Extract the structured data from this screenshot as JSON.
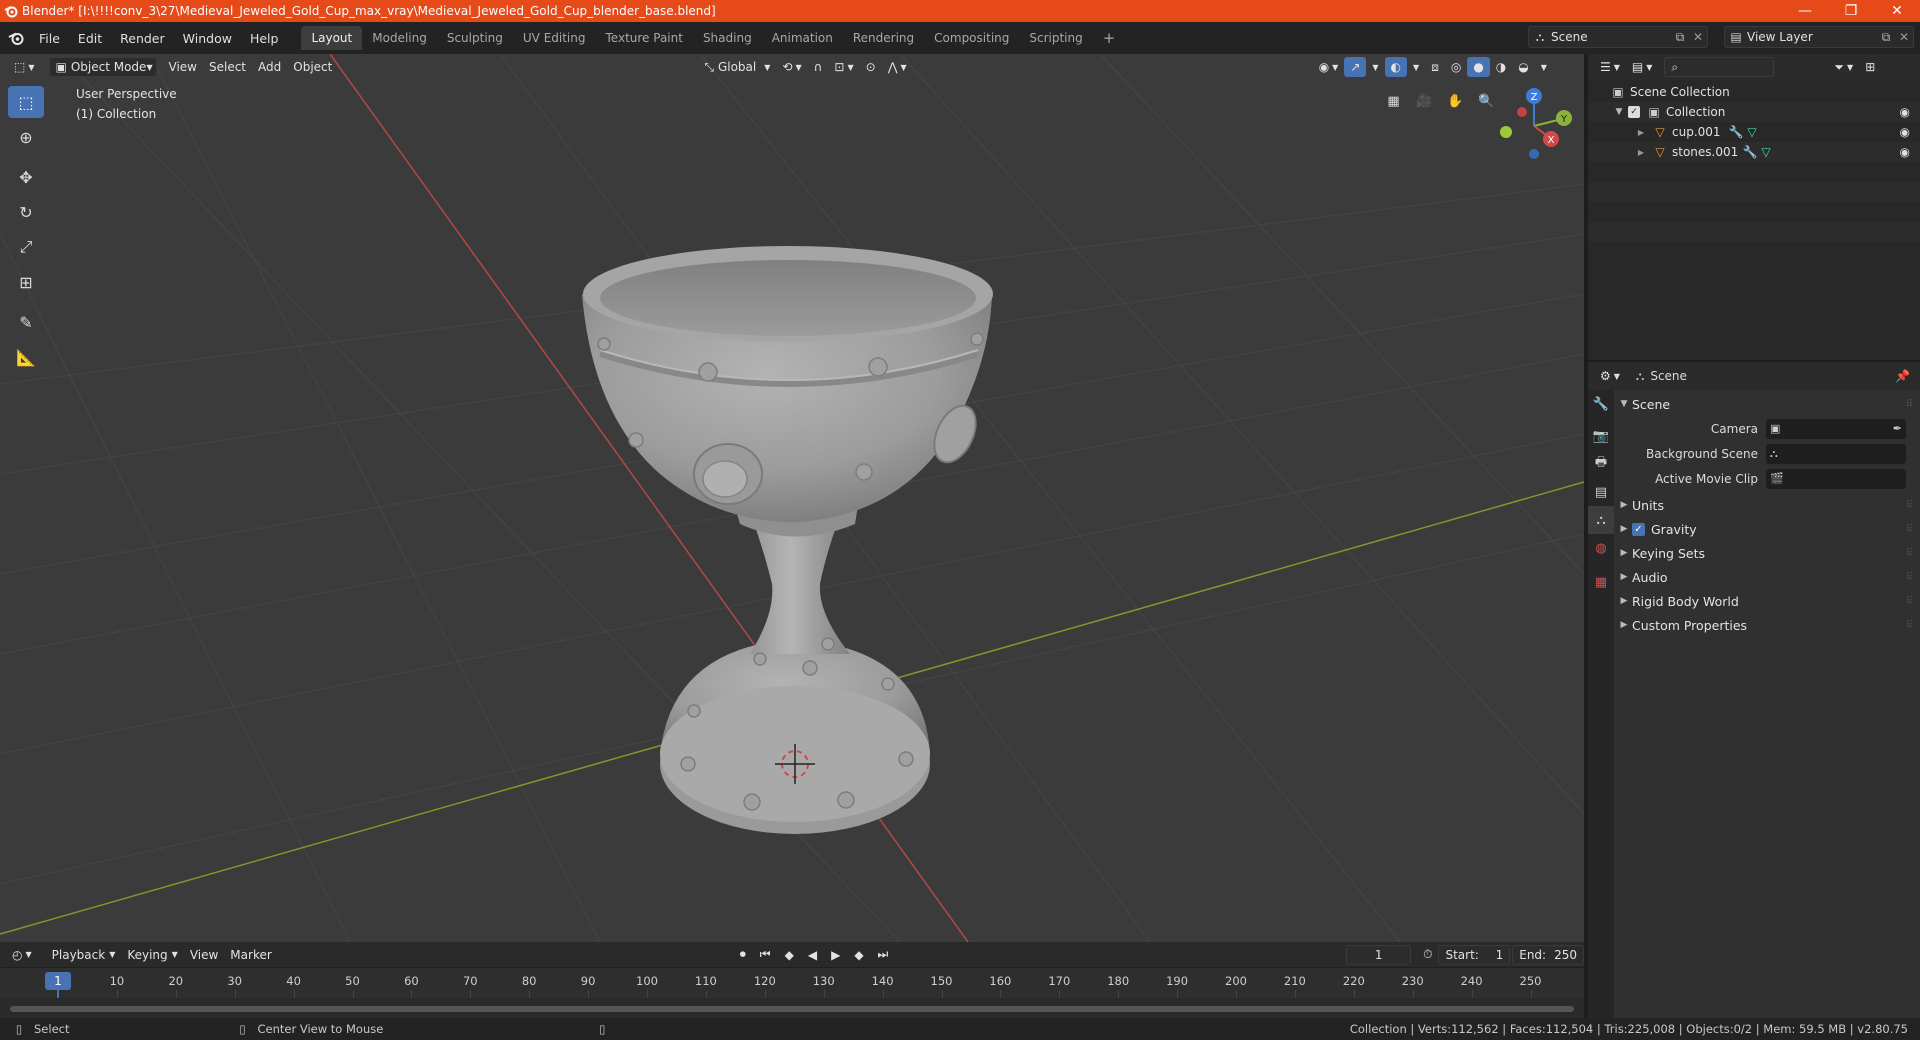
{
  "window": {
    "title": "Blender* [I:\\!!!!conv_3\\27\\Medieval_Jeweled_Gold_Cup_max_vray\\Medieval_Jeweled_Gold_Cup_blender_base.blend]",
    "minimize": "—",
    "maximize": "❐",
    "close": "✕"
  },
  "menu": {
    "items": [
      "File",
      "Edit",
      "Render",
      "Window",
      "Help"
    ]
  },
  "workspaces": {
    "tabs": [
      "Layout",
      "Modeling",
      "Sculpting",
      "UV Editing",
      "Texture Paint",
      "Shading",
      "Animation",
      "Rendering",
      "Compositing",
      "Scripting"
    ],
    "active": "Layout",
    "add": "+"
  },
  "scene_selector": {
    "value": "Scene"
  },
  "view_layer_selector": {
    "value": "View Layer"
  },
  "viewport": {
    "mode": "Object Mode",
    "menus": [
      "View",
      "Select",
      "Add",
      "Object"
    ],
    "orientation": "Global",
    "info_line1": "User Perspective",
    "info_line2": "(1) Collection",
    "gizmo": {
      "z": "Z",
      "y": "Y",
      "x": "X"
    }
  },
  "outliner": {
    "search_placeholder": "",
    "root": "Scene Collection",
    "collection": "Collection",
    "objects": [
      "cup.001",
      "stones.001"
    ]
  },
  "properties": {
    "header_title": "Scene",
    "section": "Scene",
    "fields": {
      "camera_label": "Camera",
      "background_scene_label": "Background Scene",
      "active_movie_clip_label": "Active Movie Clip"
    },
    "panels": [
      "Units",
      "Gravity",
      "Keying Sets",
      "Audio",
      "Rigid Body World",
      "Custom Properties"
    ],
    "gravity_checked": true
  },
  "timeline": {
    "menus": [
      "Playback",
      "Keying",
      "View",
      "Marker"
    ],
    "current_frame": "1",
    "start_label": "Start:",
    "start_value": "1",
    "end_label": "End:",
    "end_value": "250",
    "ticks": [
      "1",
      "10",
      "20",
      "30",
      "40",
      "50",
      "60",
      "70",
      "80",
      "90",
      "100",
      "110",
      "120",
      "130",
      "140",
      "150",
      "160",
      "170",
      "180",
      "190",
      "200",
      "210",
      "220",
      "230",
      "240",
      "250"
    ]
  },
  "statusbar": {
    "select": "Select",
    "center_view": "Center View to Mouse",
    "stats": "Collection | Verts:112,562 | Faces:112,504 | Tris:225,008 | Objects:0/2 | Mem: 59.5 MB | v2.80.75"
  },
  "colors": {
    "titlebar": "#e64a19",
    "accent": "#4772b3",
    "x_axis": "#d04848",
    "y_axis": "#8bb33a",
    "z_axis": "#3e7bd6"
  }
}
